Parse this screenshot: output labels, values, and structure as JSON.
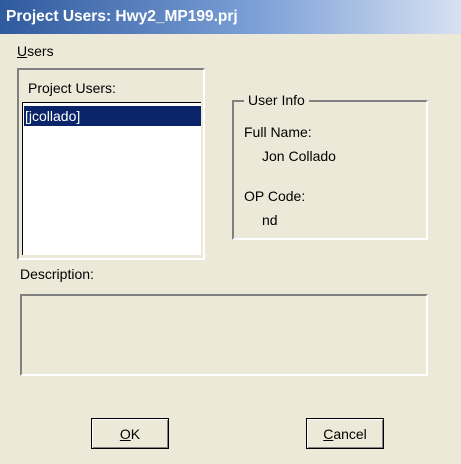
{
  "window": {
    "title": "Project Users: Hwy2_MP199.prj"
  },
  "menu": {
    "users_mnemonic": "U",
    "users_rest": "sers"
  },
  "project_users": {
    "label": "Project Users:",
    "items": [
      "[jcollado]"
    ],
    "selected_index": 0
  },
  "user_info": {
    "legend": "User Info",
    "full_name_label": "Full Name:",
    "full_name_value": "Jon Collado",
    "op_code_label": "OP Code:",
    "op_code_value": "nd"
  },
  "description": {
    "label": "Description:",
    "value": ""
  },
  "buttons": {
    "ok_mnemonic": "O",
    "ok_rest": "K",
    "cancel_mnemonic": "C",
    "cancel_rest": "ancel"
  },
  "colors": {
    "titlebar_start": "#2f5a9e",
    "selection": "#0a246a",
    "dialog_face": "#ece9d8"
  }
}
